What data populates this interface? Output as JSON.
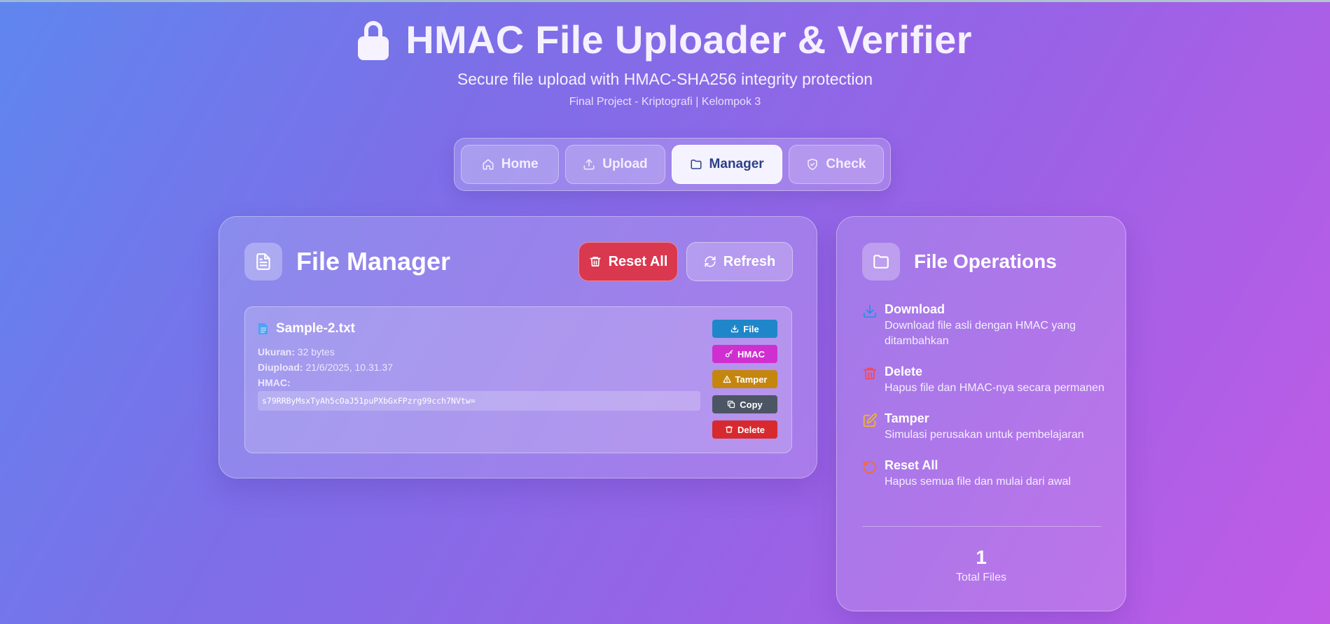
{
  "header": {
    "title": "HMAC File Uploader & Verifier",
    "subtitle": "Secure file upload with HMAC-SHA256 integrity protection",
    "course": "Final Project - Kriptografi | Kelompok 3"
  },
  "nav": {
    "tabs": [
      {
        "label": "Home",
        "icon": "home-icon"
      },
      {
        "label": "Upload",
        "icon": "upload-icon"
      },
      {
        "label": "Manager",
        "icon": "folder-icon",
        "active": true
      },
      {
        "label": "Check",
        "icon": "shield-check-icon"
      }
    ]
  },
  "file_manager": {
    "title": "File Manager",
    "reset_all_label": "Reset All",
    "refresh_label": "Refresh",
    "files": [
      {
        "name": "Sample-2.txt",
        "size_label": "Ukuran:",
        "size": "32 bytes",
        "uploaded_label": "Diupload:",
        "uploaded": "21/6/2025, 10.31.37",
        "hmac_label": "HMAC:",
        "hmac": "s79RRByMsxTyAh5cOaJ51puPXbGxFPzrg99cch7NVtw=",
        "actions": {
          "file": "File",
          "hmac": "HMAC",
          "tamper": "Tamper",
          "copy": "Copy",
          "delete": "Delete"
        }
      }
    ]
  },
  "file_operations": {
    "title": "File Operations",
    "items": [
      {
        "title": "Download",
        "desc": "Download file asli dengan HMAC yang ditambahkan",
        "icon": "download-icon",
        "color": "#2a8fe6"
      },
      {
        "title": "Delete",
        "desc": "Hapus file dan HMAC-nya secara permanen",
        "icon": "trash-icon",
        "color": "#f04a5a"
      },
      {
        "title": "Tamper",
        "desc": "Simulasi perusakan untuk pembelajaran",
        "icon": "edit-icon",
        "color": "#f0b429"
      },
      {
        "title": "Reset All",
        "desc": "Hapus semua file dan mulai dari awal",
        "icon": "rotate-ccw-icon",
        "color": "#f06a3c"
      }
    ],
    "total_count": "1",
    "total_label": "Total Files"
  }
}
